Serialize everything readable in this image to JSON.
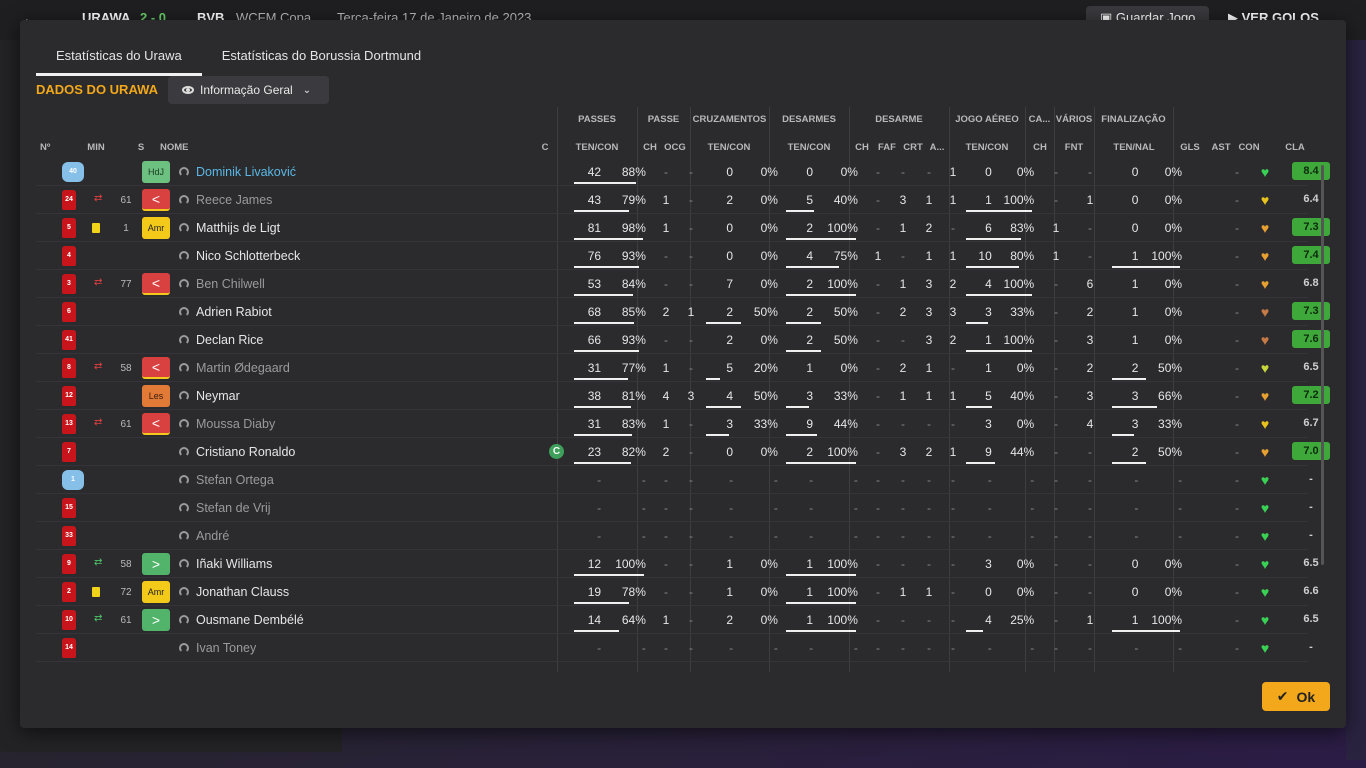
{
  "background": {
    "team_a": "URAWA",
    "score": "2 - 0",
    "team_b": "BVB",
    "competition": "WCFM Copa",
    "date": "Terça-feira 17 de Janeiro de 2023",
    "save_label": "Guardar Jogo",
    "goals_label": "VER GOLOS"
  },
  "tabs": [
    {
      "label": "Estatísticas do Urawa",
      "active": true
    },
    {
      "label": "Estatísticas do Borussia Dortmund",
      "active": false
    }
  ],
  "section_title": "DADOS DO URAWA",
  "view_select": "Informação Geral",
  "groups": [
    "PASSES",
    "PASSE",
    "CRUZAMENTOS",
    "DESARMES",
    "DESARME",
    "JOGO AÉREO",
    "CA...",
    "VÁRIOS",
    "FINALIZAÇÃO"
  ],
  "headers": {
    "num": "Nº",
    "min": "MIN",
    "s": "S",
    "name": "NOME",
    "c": "C",
    "passes": "TEN/CON",
    "passe_ch": "CH",
    "passe_ocg": "OCG",
    "cruz": "TEN/CON",
    "des": "TEN/CON",
    "desarme_ch": "CH",
    "desarme_faf": "FAF",
    "desarme_crt": "CRT",
    "desarme_a": "A...",
    "aereo": "TEN/CON",
    "ca_ch": "CH",
    "varios_fnt": "FNT",
    "final": "TEN/NAL",
    "gls": "GLS",
    "ast": "AST",
    "con": "CON",
    "cla": "CLA"
  },
  "players": [
    {
      "num": "40",
      "gk": true,
      "card": "",
      "sub": "",
      "min": "",
      "pos": "HdJ",
      "pos_type": "gk",
      "name": "Dominik Livaković",
      "name_style": "link",
      "captain": false,
      "passes": [
        "42",
        "88%"
      ],
      "pass_pct": 0.88,
      "pch": "-",
      "pocg": "-",
      "cruz": [
        "0",
        "0%"
      ],
      "cruz_pct": 0,
      "des": [
        "0",
        "0%"
      ],
      "des_pct": 0,
      "dch": "-",
      "dfaf": "-",
      "dcrt": "-",
      "da": "1",
      "aereo": [
        "0",
        "0%"
      ],
      "aereo_pct": 0,
      "cach": "-",
      "fnt": "-",
      "fin": [
        "0",
        "0%"
      ],
      "fin_pct": 0,
      "gls": "",
      "ast": "-",
      "con": "#39d353",
      "cla": "8.4",
      "cla_good": true
    },
    {
      "num": "24",
      "gk": false,
      "card": "",
      "sub": "out",
      "min": "61",
      "pos": "<",
      "pos_type": "red",
      "name": "Reece James",
      "name_style": "dim",
      "captain": false,
      "passes": [
        "43",
        "79%"
      ],
      "pass_pct": 0.79,
      "pch": "1",
      "pocg": "-",
      "cruz": [
        "2",
        "0%"
      ],
      "cruz_pct": 0,
      "des": [
        "5",
        "40%"
      ],
      "des_pct": 0.4,
      "dch": "-",
      "dfaf": "3",
      "dcrt": "1",
      "da": "1",
      "aereo": [
        "1",
        "100%"
      ],
      "aereo_pct": 1,
      "cach": "-",
      "fnt": "1",
      "fin": [
        "0",
        "0%"
      ],
      "fin_pct": 0,
      "gls": "",
      "ast": "-",
      "con": "#e8c41a",
      "cla": "6.4",
      "cla_good": false
    },
    {
      "num": "5",
      "gk": false,
      "card": "y",
      "sub": "",
      "min": "1",
      "pos": "Amr",
      "pos_type": "amr",
      "name": "Matthijs de Ligt",
      "name_style": "",
      "captain": false,
      "passes": [
        "81",
        "98%"
      ],
      "pass_pct": 0.98,
      "pch": "1",
      "pocg": "-",
      "cruz": [
        "0",
        "0%"
      ],
      "cruz_pct": 0,
      "des": [
        "2",
        "100%"
      ],
      "des_pct": 1,
      "dch": "-",
      "dfaf": "1",
      "dcrt": "2",
      "da": "-",
      "aereo": [
        "6",
        "83%"
      ],
      "aereo_pct": 0.83,
      "cach": "1",
      "fnt": "-",
      "fin": [
        "0",
        "0%"
      ],
      "fin_pct": 0,
      "gls": "",
      "ast": "-",
      "con": "#e8a030",
      "cla": "7.3",
      "cla_good": true
    },
    {
      "num": "4",
      "gk": false,
      "card": "",
      "sub": "",
      "min": "",
      "pos": "",
      "pos_type": "",
      "name": "Nico Schlotterbeck",
      "name_style": "",
      "captain": false,
      "passes": [
        "76",
        "93%"
      ],
      "pass_pct": 0.93,
      "pch": "-",
      "pocg": "-",
      "cruz": [
        "0",
        "0%"
      ],
      "cruz_pct": 0,
      "des": [
        "4",
        "75%"
      ],
      "des_pct": 0.75,
      "dch": "1",
      "dfaf": "-",
      "dcrt": "1",
      "da": "1",
      "aereo": [
        "10",
        "80%"
      ],
      "aereo_pct": 0.8,
      "cach": "1",
      "fnt": "-",
      "fin": [
        "1",
        "100%"
      ],
      "fin_pct": 1,
      "gls": "",
      "ast": "-",
      "con": "#e8a030",
      "cla": "7.4",
      "cla_good": true
    },
    {
      "num": "3",
      "gk": false,
      "card": "",
      "sub": "out",
      "min": "77",
      "pos": "<",
      "pos_type": "red",
      "name": "Ben Chilwell",
      "name_style": "dim",
      "captain": false,
      "passes": [
        "53",
        "84%"
      ],
      "pass_pct": 0.84,
      "pch": "-",
      "pocg": "-",
      "cruz": [
        "7",
        "0%"
      ],
      "cruz_pct": 0,
      "des": [
        "2",
        "100%"
      ],
      "des_pct": 1,
      "dch": "-",
      "dfaf": "1",
      "dcrt": "3",
      "da": "2",
      "aereo": [
        "4",
        "100%"
      ],
      "aereo_pct": 1,
      "cach": "-",
      "fnt": "6",
      "fin": [
        "1",
        "0%"
      ],
      "fin_pct": 0,
      "gls": "",
      "ast": "-",
      "con": "#e8a030",
      "cla": "6.8",
      "cla_good": false
    },
    {
      "num": "6",
      "gk": false,
      "card": "",
      "sub": "",
      "min": "",
      "pos": "",
      "pos_type": "",
      "name": "Adrien Rabiot",
      "name_style": "",
      "captain": false,
      "passes": [
        "68",
        "85%"
      ],
      "pass_pct": 0.85,
      "pch": "2",
      "pocg": "1",
      "cruz": [
        "2",
        "50%"
      ],
      "cruz_pct": 0.5,
      "des": [
        "2",
        "50%"
      ],
      "des_pct": 0.5,
      "dch": "-",
      "dfaf": "2",
      "dcrt": "3",
      "da": "3",
      "aereo": [
        "3",
        "33%"
      ],
      "aereo_pct": 0.33,
      "cach": "-",
      "fnt": "2",
      "fin": [
        "1",
        "0%"
      ],
      "fin_pct": 0,
      "gls": "",
      "ast": "-",
      "con": "#c77a45",
      "cla": "7.3",
      "cla_good": true
    },
    {
      "num": "41",
      "gk": false,
      "card": "",
      "sub": "",
      "min": "",
      "pos": "",
      "pos_type": "",
      "name": "Declan Rice",
      "name_style": "",
      "captain": false,
      "passes": [
        "66",
        "93%"
      ],
      "pass_pct": 0.93,
      "pch": "-",
      "pocg": "-",
      "cruz": [
        "2",
        "0%"
      ],
      "cruz_pct": 0,
      "des": [
        "2",
        "50%"
      ],
      "des_pct": 0.5,
      "dch": "-",
      "dfaf": "-",
      "dcrt": "3",
      "da": "2",
      "aereo": [
        "1",
        "100%"
      ],
      "aereo_pct": 1,
      "cach": "-",
      "fnt": "3",
      "fin": [
        "1",
        "0%"
      ],
      "fin_pct": 0,
      "gls": "",
      "ast": "-",
      "con": "#c77a45",
      "cla": "7.6",
      "cla_good": true
    },
    {
      "num": "8",
      "gk": false,
      "card": "",
      "sub": "out",
      "min": "58",
      "pos": "<",
      "pos_type": "red",
      "name": "Martin Ødegaard",
      "name_style": "dim",
      "captain": false,
      "passes": [
        "31",
        "77%"
      ],
      "pass_pct": 0.77,
      "pch": "1",
      "pocg": "-",
      "cruz": [
        "5",
        "20%"
      ],
      "cruz_pct": 0.2,
      "des": [
        "1",
        "0%"
      ],
      "des_pct": 0,
      "dch": "-",
      "dfaf": "2",
      "dcrt": "1",
      "da": "-",
      "aereo": [
        "1",
        "0%"
      ],
      "aereo_pct": 0,
      "cach": "-",
      "fnt": "2",
      "fin": [
        "2",
        "50%"
      ],
      "fin_pct": 0.5,
      "gls": "",
      "ast": "-",
      "con": "#c8d83a",
      "cla": "6.5",
      "cla_good": false
    },
    {
      "num": "12",
      "gk": false,
      "card": "",
      "sub": "",
      "min": "",
      "pos": "Les",
      "pos_type": "les",
      "name": "Neymar",
      "name_style": "",
      "captain": false,
      "passes": [
        "38",
        "81%"
      ],
      "pass_pct": 0.81,
      "pch": "4",
      "pocg": "3",
      "cruz": [
        "4",
        "50%"
      ],
      "cruz_pct": 0.5,
      "des": [
        "3",
        "33%"
      ],
      "des_pct": 0.33,
      "dch": "-",
      "dfaf": "1",
      "dcrt": "1",
      "da": "1",
      "aereo": [
        "5",
        "40%"
      ],
      "aereo_pct": 0.4,
      "cach": "-",
      "fnt": "3",
      "fin": [
        "3",
        "66%"
      ],
      "fin_pct": 0.66,
      "gls": "",
      "ast": "-",
      "con": "#e8a030",
      "cla": "7.2",
      "cla_good": true
    },
    {
      "num": "13",
      "gk": false,
      "card": "",
      "sub": "out",
      "min": "61",
      "pos": "<",
      "pos_type": "red",
      "name": "Moussa Diaby",
      "name_style": "dim",
      "captain": false,
      "passes": [
        "31",
        "83%"
      ],
      "pass_pct": 0.83,
      "pch": "1",
      "pocg": "-",
      "cruz": [
        "3",
        "33%"
      ],
      "cruz_pct": 0.33,
      "des": [
        "9",
        "44%"
      ],
      "des_pct": 0.44,
      "dch": "-",
      "dfaf": "-",
      "dcrt": "-",
      "da": "-",
      "aereo": [
        "3",
        "0%"
      ],
      "aereo_pct": 0,
      "cach": "-",
      "fnt": "4",
      "fin": [
        "3",
        "33%"
      ],
      "fin_pct": 0.33,
      "gls": "",
      "ast": "-",
      "con": "#e8c41a",
      "cla": "6.7",
      "cla_good": false
    },
    {
      "num": "7",
      "gk": false,
      "card": "",
      "sub": "",
      "min": "",
      "pos": "",
      "pos_type": "",
      "name": "Cristiano Ronaldo",
      "name_style": "",
      "captain": true,
      "passes": [
        "23",
        "82%"
      ],
      "pass_pct": 0.82,
      "pch": "2",
      "pocg": "-",
      "cruz": [
        "0",
        "0%"
      ],
      "cruz_pct": 0,
      "des": [
        "2",
        "100%"
      ],
      "des_pct": 1,
      "dch": "-",
      "dfaf": "3",
      "dcrt": "2",
      "da": "1",
      "aereo": [
        "9",
        "44%"
      ],
      "aereo_pct": 0.44,
      "cach": "-",
      "fnt": "-",
      "fin": [
        "2",
        "50%"
      ],
      "fin_pct": 0.5,
      "gls": "",
      "ast": "-",
      "con": "#e8a030",
      "cla": "7.0",
      "cla_good": true
    },
    {
      "num": "1",
      "gk": true,
      "card": "",
      "sub": "",
      "min": "",
      "pos": "",
      "pos_type": "",
      "name": "Stefan Ortega",
      "name_style": "dim",
      "captain": false,
      "passes": [
        "-",
        "-"
      ],
      "pass_pct": 0,
      "pch": "-",
      "pocg": "-",
      "cruz": [
        "-",
        "-"
      ],
      "cruz_pct": 0,
      "des": [
        "-",
        "-"
      ],
      "des_pct": 0,
      "dch": "-",
      "dfaf": "-",
      "dcrt": "-",
      "da": "-",
      "aereo": [
        "-",
        "-"
      ],
      "aereo_pct": 0,
      "cach": "-",
      "fnt": "-",
      "fin": [
        "-",
        "-"
      ],
      "fin_pct": 0,
      "gls": "",
      "ast": "-",
      "con": "#39d353",
      "cla": "-",
      "cla_good": false,
      "empty": true
    },
    {
      "num": "15",
      "gk": false,
      "card": "",
      "sub": "",
      "min": "",
      "pos": "",
      "pos_type": "",
      "name": "Stefan de Vrij",
      "name_style": "dim",
      "captain": false,
      "passes": [
        "-",
        "-"
      ],
      "pass_pct": 0,
      "pch": "-",
      "pocg": "-",
      "cruz": [
        "-",
        "-"
      ],
      "cruz_pct": 0,
      "des": [
        "-",
        "-"
      ],
      "des_pct": 0,
      "dch": "-",
      "dfaf": "-",
      "dcrt": "-",
      "da": "-",
      "aereo": [
        "-",
        "-"
      ],
      "aereo_pct": 0,
      "cach": "-",
      "fnt": "-",
      "fin": [
        "-",
        "-"
      ],
      "fin_pct": 0,
      "gls": "",
      "ast": "-",
      "con": "#39d353",
      "cla": "-",
      "cla_good": false,
      "empty": true
    },
    {
      "num": "33",
      "gk": false,
      "card": "",
      "sub": "",
      "min": "",
      "pos": "",
      "pos_type": "",
      "name": "André",
      "name_style": "dim",
      "captain": false,
      "passes": [
        "-",
        "-"
      ],
      "pass_pct": 0,
      "pch": "-",
      "pocg": "-",
      "cruz": [
        "-",
        "-"
      ],
      "cruz_pct": 0,
      "des": [
        "-",
        "-"
      ],
      "des_pct": 0,
      "dch": "-",
      "dfaf": "-",
      "dcrt": "-",
      "da": "-",
      "aereo": [
        "-",
        "-"
      ],
      "aereo_pct": 0,
      "cach": "-",
      "fnt": "-",
      "fin": [
        "-",
        "-"
      ],
      "fin_pct": 0,
      "gls": "",
      "ast": "-",
      "con": "#39d353",
      "cla": "-",
      "cla_good": false,
      "empty": true
    },
    {
      "num": "9",
      "gk": false,
      "card": "",
      "sub": "in",
      "min": "58",
      "pos": ">",
      "pos_type": "grn",
      "name": "Iñaki Williams",
      "name_style": "",
      "captain": false,
      "passes": [
        "12",
        "100%"
      ],
      "pass_pct": 1,
      "pch": "-",
      "pocg": "-",
      "cruz": [
        "1",
        "0%"
      ],
      "cruz_pct": 0,
      "des": [
        "1",
        "100%"
      ],
      "des_pct": 1,
      "dch": "-",
      "dfaf": "-",
      "dcrt": "-",
      "da": "-",
      "aereo": [
        "3",
        "0%"
      ],
      "aereo_pct": 0,
      "cach": "-",
      "fnt": "-",
      "fin": [
        "0",
        "0%"
      ],
      "fin_pct": 0,
      "gls": "",
      "ast": "-",
      "con": "#39d353",
      "cla": "6.5",
      "cla_good": false
    },
    {
      "num": "2",
      "gk": false,
      "card": "y",
      "sub": "",
      "min": "72",
      "pos": "Amr",
      "pos_type": "amr",
      "name": "Jonathan Clauss",
      "name_style": "",
      "captain": false,
      "passes": [
        "19",
        "78%"
      ],
      "pass_pct": 0.78,
      "pch": "-",
      "pocg": "-",
      "cruz": [
        "1",
        "0%"
      ],
      "cruz_pct": 0,
      "des": [
        "1",
        "100%"
      ],
      "des_pct": 1,
      "dch": "-",
      "dfaf": "1",
      "dcrt": "1",
      "da": "-",
      "aereo": [
        "0",
        "0%"
      ],
      "aereo_pct": 0,
      "cach": "-",
      "fnt": "-",
      "fin": [
        "0",
        "0%"
      ],
      "fin_pct": 0,
      "gls": "",
      "ast": "-",
      "con": "#39d353",
      "cla": "6.6",
      "cla_good": false
    },
    {
      "num": "10",
      "gk": false,
      "card": "",
      "sub": "in",
      "min": "61",
      "pos": ">",
      "pos_type": "grn",
      "name": "Ousmane Dembélé",
      "name_style": "",
      "captain": false,
      "passes": [
        "14",
        "64%"
      ],
      "pass_pct": 0.64,
      "pch": "1",
      "pocg": "-",
      "cruz": [
        "2",
        "0%"
      ],
      "cruz_pct": 0,
      "des": [
        "1",
        "100%"
      ],
      "des_pct": 1,
      "dch": "-",
      "dfaf": "-",
      "dcrt": "-",
      "da": "-",
      "aereo": [
        "4",
        "25%"
      ],
      "aereo_pct": 0.25,
      "cach": "-",
      "fnt": "1",
      "fin": [
        "1",
        "100%"
      ],
      "fin_pct": 1,
      "gls": "",
      "ast": "-",
      "con": "#39d353",
      "cla": "6.5",
      "cla_good": false
    },
    {
      "num": "14",
      "gk": false,
      "card": "",
      "sub": "",
      "min": "",
      "pos": "",
      "pos_type": "",
      "name": "Ivan Toney",
      "name_style": "dim",
      "captain": false,
      "passes": [
        "-",
        "-"
      ],
      "pass_pct": 0,
      "pch": "-",
      "pocg": "-",
      "cruz": [
        "-",
        "-"
      ],
      "cruz_pct": 0,
      "des": [
        "-",
        "-"
      ],
      "des_pct": 0,
      "dch": "-",
      "dfaf": "-",
      "dcrt": "-",
      "da": "-",
      "aereo": [
        "-",
        "-"
      ],
      "aereo_pct": 0,
      "cach": "-",
      "fnt": "-",
      "fin": [
        "-",
        "-"
      ],
      "fin_pct": 0,
      "gls": "",
      "ast": "-",
      "con": "#39d353",
      "cla": "-",
      "cla_good": false,
      "empty": true
    }
  ],
  "ok_label": "Ok"
}
